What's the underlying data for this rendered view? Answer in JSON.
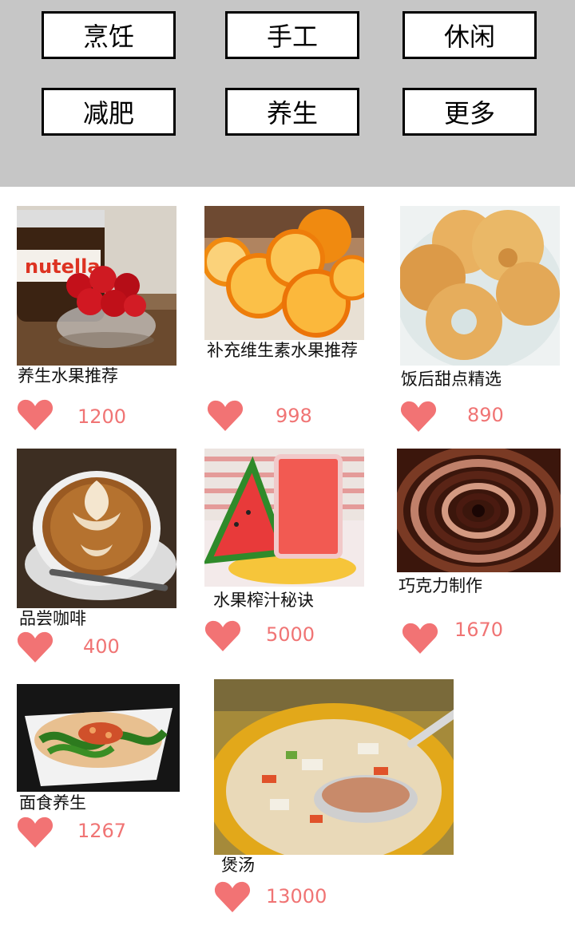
{
  "categories": [
    "烹饪",
    "手工",
    "休闲",
    "减肥",
    "养生",
    "更多"
  ],
  "posts": [
    {
      "title": "养生水果推荐",
      "likes": "1200",
      "image": "nutella-strawberries"
    },
    {
      "title": "补充维生素水果推荐",
      "likes": "998",
      "image": "oranges"
    },
    {
      "title": "饭后甜点精选",
      "likes": "890",
      "image": "butter-cookies"
    },
    {
      "title": "品尝咖啡",
      "likes": "400",
      "image": "latte-art"
    },
    {
      "title": "水果榨汁秘诀",
      "likes": "5000",
      "image": "watermelon-juice"
    },
    {
      "title": "巧克力制作",
      "likes": "1670",
      "image": "chocolate-swirl"
    },
    {
      "title": "面食养生",
      "likes": "1267",
      "image": "noodle-dish"
    },
    {
      "title": "煲汤",
      "likes": "13000",
      "image": "soup-bowl"
    }
  ],
  "colors": {
    "topbar": "#c6c6c6",
    "heart": "#f27374",
    "count": "#f07474"
  }
}
